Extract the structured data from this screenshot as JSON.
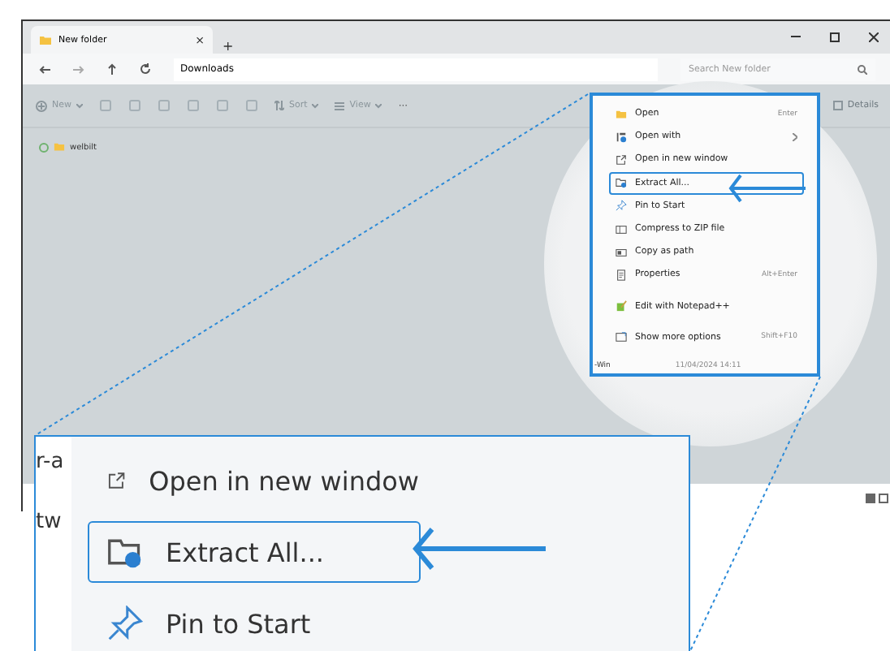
{
  "window": {
    "tab_title": "New folder",
    "tab_close": "×",
    "new_tab": "+"
  },
  "address_bar": {
    "path": "Downloads",
    "search_placeholder": "Search New folder"
  },
  "toolbar": {
    "new_label": "New",
    "sort_label": "Sort",
    "view_label": "View",
    "more": "···",
    "details_label": "Details"
  },
  "files": [
    {
      "name": "welbilt"
    }
  ],
  "context_menu": {
    "items": [
      {
        "label": "Open",
        "shortcut": "Enter",
        "submenu": false,
        "highlighted": false,
        "separator_before": false
      },
      {
        "label": "Open with",
        "submenu": true,
        "highlighted": false,
        "separator_before": false
      },
      {
        "label": "Open in new window",
        "submenu": false,
        "highlighted": false,
        "separator_before": false
      },
      {
        "label": "Extract All...",
        "submenu": false,
        "highlighted": true,
        "separator_before": false
      },
      {
        "label": "Pin to Start",
        "submenu": false,
        "highlighted": false,
        "separator_before": false
      },
      {
        "label": "Compress to ZIP file",
        "submenu": false,
        "highlighted": false,
        "separator_before": false
      },
      {
        "label": "Copy as path",
        "submenu": false,
        "highlighted": false,
        "separator_before": false
      },
      {
        "label": "Properties",
        "shortcut": "Alt+Enter",
        "submenu": false,
        "highlighted": false,
        "separator_before": false
      },
      {
        "label": "Edit with Notepad++",
        "submenu": false,
        "highlighted": false,
        "separator_before": true
      },
      {
        "label": "Show more options",
        "shortcut": "Shift+F10",
        "submenu": false,
        "highlighted": false,
        "separator_before": true
      }
    ],
    "footer_name": "-Win",
    "footer_date": "11/04/2024 14:11"
  },
  "zoom_panel": {
    "fragments": [
      "r-a",
      "tw"
    ],
    "items": [
      {
        "label": "Open in new window",
        "highlighted": false
      },
      {
        "label": "Extract All...",
        "highlighted": true
      },
      {
        "label": "Pin to Start",
        "highlighted": false
      }
    ]
  }
}
